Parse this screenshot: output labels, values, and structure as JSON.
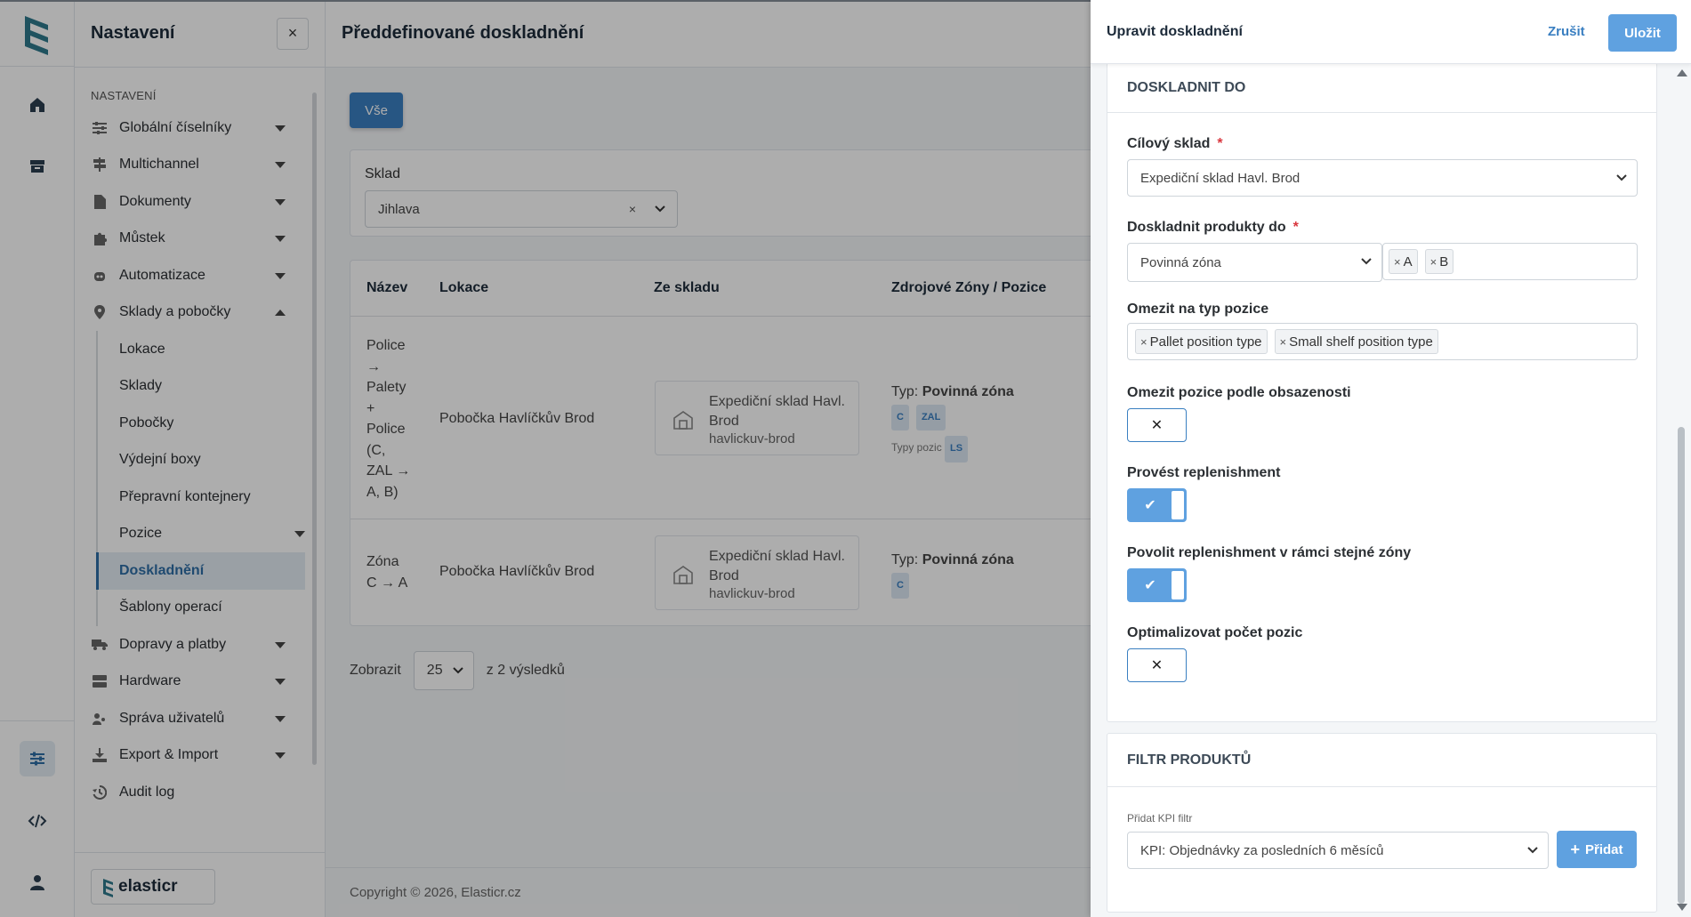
{
  "rail": {
    "icons": [
      "logo-icon",
      "home-icon",
      "archive-icon",
      "settings-sliders-icon",
      "code-icon",
      "user-icon"
    ]
  },
  "sidebar": {
    "title": "Nastavení",
    "close": "×",
    "section": "NASTAVENÍ",
    "items": [
      {
        "label": "Globální číselníky",
        "icon": "sliders-icon"
      },
      {
        "label": "Multichannel",
        "icon": "signpost-icon"
      },
      {
        "label": "Dokumenty",
        "icon": "file-icon"
      },
      {
        "label": "Můstek",
        "icon": "puzzle-icon"
      },
      {
        "label": "Automatizace",
        "icon": "robot-icon"
      },
      {
        "label": "Sklady a pobočky",
        "icon": "map-pin-icon"
      }
    ],
    "sub_items": [
      "Lokace",
      "Sklady",
      "Pobočky",
      "Výdejní boxy",
      "Přepravní kontejnery",
      "Pozice",
      "Doskladnění",
      "Šablony operací"
    ],
    "bottom_items": [
      {
        "label": "Dopravy a platby",
        "icon": "truck-icon"
      },
      {
        "label": "Hardware",
        "icon": "server-icon"
      },
      {
        "label": "Správa uživatelů",
        "icon": "users-icon"
      },
      {
        "label": "Export & Import",
        "icon": "download-icon"
      },
      {
        "label": "Audit log",
        "icon": "history-icon"
      }
    ],
    "brand": "elasticr"
  },
  "main": {
    "title": "Předdefinované doskladnění",
    "all_button": "Vše",
    "filter_label": "Sklad",
    "filter_value": "Jihlava",
    "filter_clear": "×",
    "columns": [
      "Název",
      "Lokace",
      "Ze skladu",
      "Zdrojové Zóny / Pozice"
    ],
    "rows": [
      {
        "name_lines": [
          "Police",
          "→",
          "Palety",
          "+",
          "Police",
          "(C,",
          "ZAL →",
          "A, B)"
        ],
        "location": "Pobočka Havlíčkův Brod",
        "warehouse": "Expediční sklad Havl. Brod",
        "warehouse_code": "havlickuv-brod",
        "type_prefix": "Typ:",
        "type_value": "Povinná zóna",
        "zones": [
          "C",
          "ZAL"
        ],
        "position_types_label": "Typy pozic",
        "position_types": [
          "LS"
        ]
      },
      {
        "name_lines": [
          "Zóna",
          "C → A"
        ],
        "location": "Pobočka Havlíčkův Brod",
        "warehouse": "Expediční sklad Havl. Brod",
        "warehouse_code": "havlickuv-brod",
        "type_prefix": "Typ:",
        "type_value": "Povinná zóna",
        "zones": [
          "C"
        ]
      }
    ],
    "pager_show": "Zobrazit",
    "pager_size": "25",
    "pager_total": "z 2 výsledků",
    "copyright": "Copyright © 2026, Elasticr.cz"
  },
  "panel": {
    "title": "Upravit doskladnění",
    "cancel": "Zrušit",
    "save": "Uložit",
    "section1_title": "DOSKLADNIT DO",
    "target_label": "Cílový sklad",
    "required_mark": "*",
    "target_value": "Expediční sklad Havl. Brod",
    "products_label": "Doskladnit produkty do",
    "products_mode": "Povinná zóna",
    "products_zones": [
      "A",
      "B"
    ],
    "position_type_label": "Omezit na typ pozice",
    "position_types": [
      "Pallet position type",
      "Small shelf position type"
    ],
    "occupancy_label": "Omezit pozice podle obsazenosti",
    "occupancy_on": false,
    "replenish_label": "Provést replenishment",
    "replenish_on": true,
    "same_zone_label": "Povolit replenishment v rámci stejné zóny",
    "same_zone_on": true,
    "optimize_label": "Optimalizovat počet pozic",
    "optimize_on": false,
    "section2_title": "FILTR PRODUKTŮ",
    "kpi_label": "Přidat KPI filtr",
    "kpi_value": "KPI: Objednávky za posledních 6 měsíců",
    "add_button": "Přidat",
    "add_plus": "+",
    "remove_x": "×",
    "check": "✔",
    "cross": "✕"
  }
}
